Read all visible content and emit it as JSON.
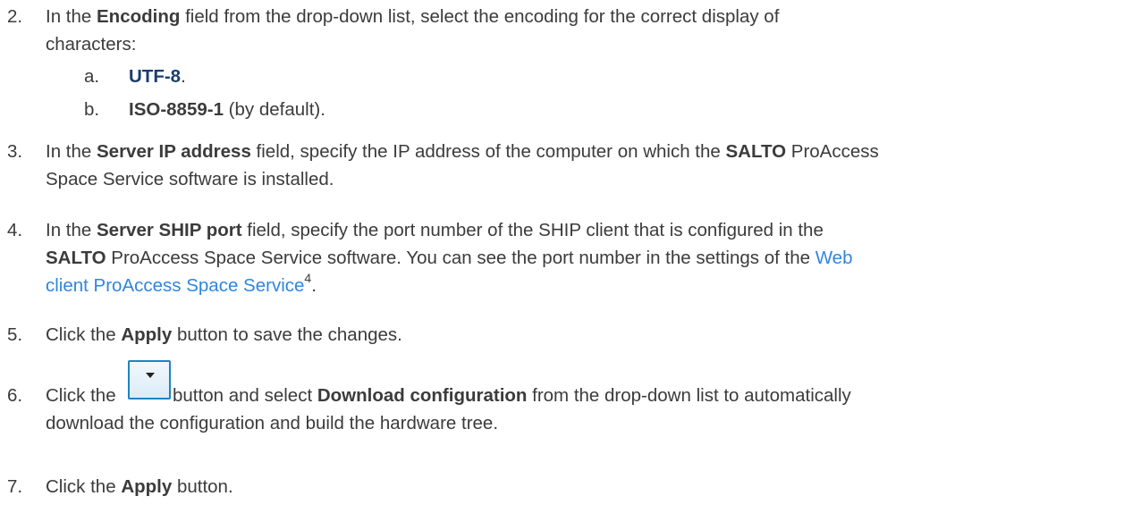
{
  "steps": [
    {
      "number": "2.",
      "text": {
        "a": "In the ",
        "b": "Encoding",
        "c": " field from the drop-down list, select the encoding for the correct display of",
        "d": "characters:"
      },
      "options": [
        {
          "letter": "a.",
          "value": "UTF-8",
          "suffix": "."
        },
        {
          "letter": "b.",
          "value": "ISO-8859-1",
          "suffix": " (by default)."
        }
      ]
    },
    {
      "number": "3.",
      "text": {
        "a": "In the ",
        "b": "Server IP address",
        "c": " field, specify the IP address of the computer on which the ",
        "d": "SALTO",
        "e": " ProAccess",
        "f": "Space Service software is installed."
      }
    },
    {
      "number": "4.",
      "text": {
        "a": "In the ",
        "b": "Server SHIP port",
        "c": " field, specify the port number of the SHIP client that is configured in the",
        "d": "SALTO",
        "e": " ProAccess Space Service software. You can see the port number in the settings of the ",
        "link1": "Web",
        "link2": "client ProAccess Space Service",
        "footnote": "4",
        "end": "."
      }
    },
    {
      "number": "5.",
      "text": {
        "a": "Click the ",
        "b": "Apply",
        "c": " button to save the changes."
      }
    },
    {
      "number": "6.",
      "text": {
        "a": "Click the",
        "c": " button and select ",
        "d": "Download configuration",
        "e": " from the drop-down list to automatically",
        "f": "download the configuration and build the hardware tree."
      },
      "button_icon": "chevron-down-icon"
    },
    {
      "number": "7.",
      "text": {
        "a": "Click the ",
        "b": "Apply",
        "c": " button."
      }
    }
  ],
  "colors": {
    "text": "#3b3b3b",
    "option_value": "#1a3d6e",
    "link": "#2f86e0",
    "button_border": "#1a85c7"
  }
}
